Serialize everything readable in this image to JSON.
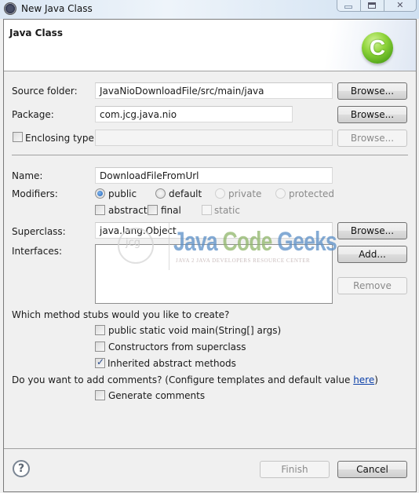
{
  "window": {
    "title": "New Java Class",
    "controls": [
      "minimize",
      "maximize",
      "close"
    ]
  },
  "banner": {
    "title": "Java Class",
    "icon": "java-class-c-icon"
  },
  "form": {
    "source_folder": {
      "label": "Source folder:",
      "value": "JavaNioDownloadFile/src/main/java",
      "button": "Browse..."
    },
    "package": {
      "label": "Package:",
      "value": "com.jcg.java.nio",
      "button": "Browse..."
    },
    "enclosing_type": {
      "label": "Enclosing type:",
      "checked": false,
      "value": "",
      "button": "Browse..."
    },
    "name": {
      "label": "Name:",
      "value": "DownloadFileFromUrl"
    },
    "modifiers": {
      "label": "Modifiers:",
      "access": [
        {
          "label": "public",
          "selected": true,
          "enabled": true
        },
        {
          "label": "default",
          "selected": false,
          "enabled": true
        },
        {
          "label": "private",
          "selected": false,
          "enabled": false
        },
        {
          "label": "protected",
          "selected": false,
          "enabled": false
        }
      ],
      "flags": [
        {
          "label": "abstract",
          "checked": false,
          "enabled": true
        },
        {
          "label": "final",
          "checked": false,
          "enabled": true
        },
        {
          "label": "static",
          "checked": false,
          "enabled": false
        }
      ]
    },
    "superclass": {
      "label": "Superclass:",
      "value": "java.lang.Object",
      "button": "Browse..."
    },
    "interfaces": {
      "label": "Interfaces:",
      "items": [],
      "add_button": "Add...",
      "remove_button": "Remove"
    },
    "stubs": {
      "question": "Which method stubs would you like to create?",
      "options": [
        {
          "label": "public static void main(String[] args)",
          "checked": false
        },
        {
          "label": "Constructors from superclass",
          "checked": false
        },
        {
          "label": "Inherited abstract methods",
          "checked": true
        }
      ]
    },
    "comments": {
      "question_prefix": "Do you want to add comments? (Configure templates and default value ",
      "link": "here",
      "question_suffix": ")",
      "option": {
        "label": "Generate comments",
        "checked": false
      }
    }
  },
  "footer": {
    "help_icon": "?",
    "finish": "Finish",
    "cancel": "Cancel"
  },
  "watermark": {
    "word1": "Java",
    "word2": "Code",
    "word3": "Geeks",
    "tagline": "JAVA 2 JAVA DEVELOPERS RESOURCE CENTER",
    "badge": "jcg"
  }
}
